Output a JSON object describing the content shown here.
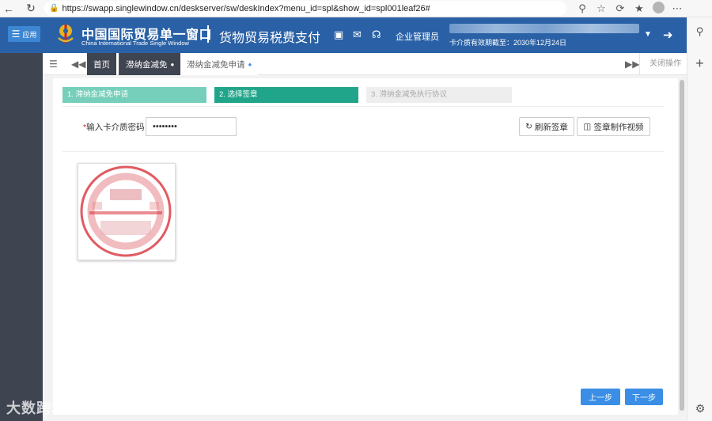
{
  "browser": {
    "url": "https://swapp.singlewindow.cn/deskserver/sw/deskIndex?menu_id=spl&show_id=spl001leaf26#"
  },
  "header": {
    "menu_label": "应用",
    "brand_cn": "中国国际贸易单一窗口",
    "brand_en": "China International Trade Single Window",
    "system_title": "货物贸易税费支付",
    "role": "企业管理员",
    "validity": "卡介质有效期截至：2030年12月24日"
  },
  "tabs": {
    "home": "首页",
    "tab1": "滞纳金减免",
    "tab2": "滞纳金减免申请",
    "close_ops": "关闭操作"
  },
  "steps": [
    "1. 滞纳金减免申请",
    "2. 选择签章",
    "3. 滞纳金减免执行协议"
  ],
  "form": {
    "password_label": "输入卡介质密码：",
    "password_value": "••••••••",
    "refresh_label": "刷新签章",
    "video_label": "签章制作视频"
  },
  "footer": {
    "prev": "上一步",
    "next": "下一步"
  },
  "watermark": "大数跨境",
  "colors": {
    "header_blue": "#2a61a6",
    "step_done": "#75cfba",
    "step_active": "#21a58a",
    "primary_button": "#3a8ee6",
    "seal_red": "#d9323b"
  }
}
